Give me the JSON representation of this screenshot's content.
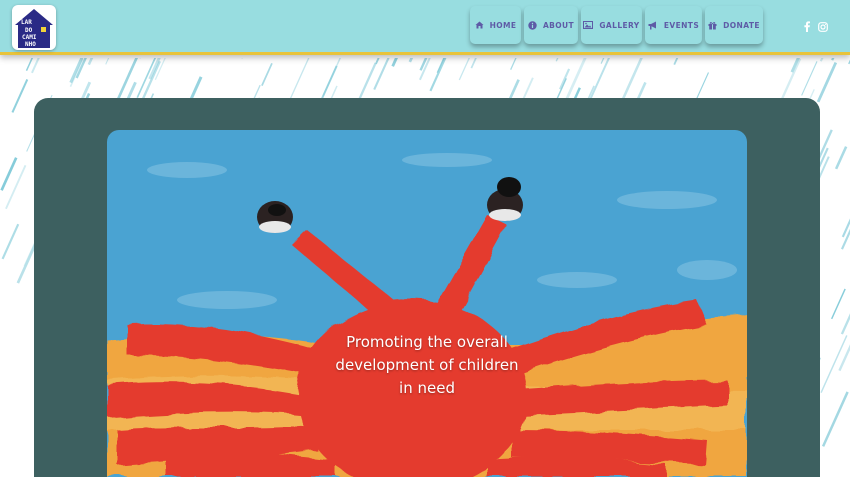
{
  "logo": {
    "lines": [
      "LAR",
      "DO",
      "CAMI",
      "NHO"
    ]
  },
  "nav": {
    "items": [
      {
        "label": "HOME",
        "icon": "home-icon"
      },
      {
        "label": "ABOUT",
        "icon": "info-icon"
      },
      {
        "label": "GALLERY",
        "icon": "image-icon"
      },
      {
        "label": "EVENTS",
        "icon": "megaphone-icon"
      },
      {
        "label": "DONATE",
        "icon": "gift-icon"
      }
    ]
  },
  "social": {
    "icons": [
      "facebook-icon",
      "instagram-icon"
    ]
  },
  "hero": {
    "line1": "Promoting the overall",
    "line2": "development of children",
    "line3": "in need",
    "image": "crab-painting"
  },
  "colors": {
    "header_bg": "#98dde0",
    "header_border": "#e8c33b",
    "nav_text": "#5e5ba6",
    "card_bg": "#3d6060",
    "sky": "#4aa3d2",
    "crab": "#e43b2f",
    "sand": "#f0a640"
  }
}
